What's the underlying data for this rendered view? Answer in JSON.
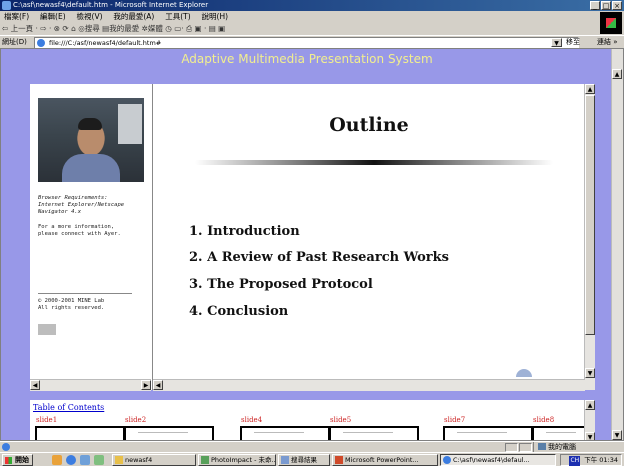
{
  "window": {
    "title": "C:\\asf\\newasf4\\default.htm - Microsoft Internet Explorer",
    "controls": [
      "_",
      "□",
      "×"
    ]
  },
  "menu": [
    "檔案(F)",
    "編輯(E)",
    "檢視(V)",
    "我的最愛(A)",
    "工具(T)",
    "說明(H)"
  ],
  "toolbar": {
    "text": "⇦ 上一頁 · ⇨ · ⊗ ⟳ ⌂   ◎搜尋  ▤我的最愛  ✲媒體  ◷  ▭· ⎙ ▣ · ▤ ▣"
  },
  "address": {
    "label": "網址(D)",
    "value": "file:///C:/asf/newasf4/default.htm#",
    "go_label": "移至",
    "links_label": "連結 »"
  },
  "page": {
    "banner": "Adaptive Multimedia Presentation System",
    "left": {
      "requirements": "Browser Requirements:\nInternet Explorer/Netscape\nNavigator 4.x",
      "contact": "For a more information,\nplease connect with Ayer.",
      "copyright": "© 2000-2001 MINE Lab\nAll rights reserved."
    },
    "slide": {
      "title": "Outline",
      "items": [
        "1. Introduction",
        "2. A Review of Past Research Works",
        "3. The Proposed Protocol",
        "4. Conclusion"
      ]
    },
    "toc": {
      "link": "Table of Contents",
      "slides": [
        "slide1",
        "slide2",
        "slide4",
        "slide5",
        "slide7",
        "slide8"
      ]
    }
  },
  "status": {
    "zone": "我的電腦"
  },
  "taskbar": {
    "start": "開始",
    "tasks": [
      "newasf4",
      "PhotoImpact - 未命...",
      "搜尋結果",
      "Microsoft PowerPoint...",
      "C:\\asf\\newasf4\\defaul..."
    ],
    "ime": "CH",
    "clock": "下午 01:34"
  }
}
